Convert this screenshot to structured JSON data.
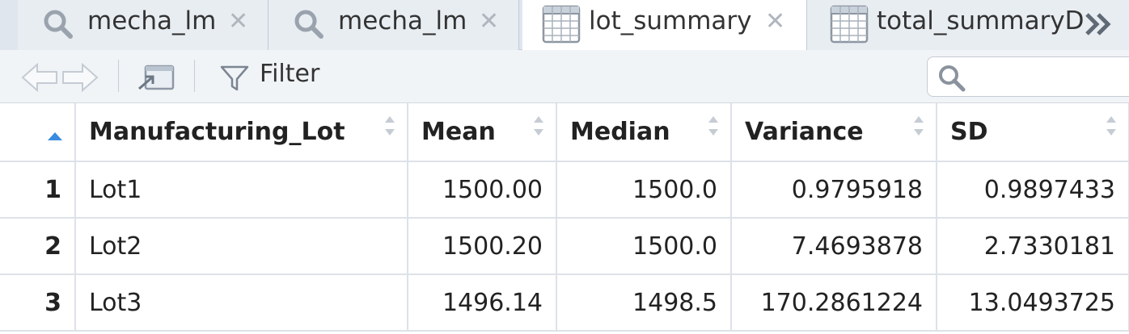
{
  "tabs": [
    {
      "label": "mecha_lm",
      "icon": "search-icon",
      "active": false
    },
    {
      "label": "mecha_lm",
      "icon": "search-icon",
      "active": false
    },
    {
      "label": "lot_summary",
      "icon": "table-icon",
      "active": true
    },
    {
      "label": "total_summaryD",
      "icon": "table-icon",
      "active": false
    }
  ],
  "toolbar": {
    "filter_label": "Filter",
    "search_placeholder": ""
  },
  "table": {
    "columns": [
      "Manufacturing_Lot",
      "Mean",
      "Median",
      "Variance",
      "SD"
    ],
    "rows": [
      {
        "index": "1",
        "cells": [
          "Lot1",
          "1500.00",
          "1500.0",
          "0.9795918",
          "0.9897433"
        ]
      },
      {
        "index": "2",
        "cells": [
          "Lot2",
          "1500.20",
          "1500.0",
          "7.4693878",
          "2.7330181"
        ]
      },
      {
        "index": "3",
        "cells": [
          "Lot3",
          "1496.14",
          "1498.5",
          "170.2861224",
          "13.0493725"
        ]
      }
    ]
  },
  "colors": {
    "tabbar_bg": "#dfe6ee",
    "toolbar_bg": "#f1f4f7",
    "sort_active": "#3a8be0",
    "grid_line": "#dde2e8"
  }
}
